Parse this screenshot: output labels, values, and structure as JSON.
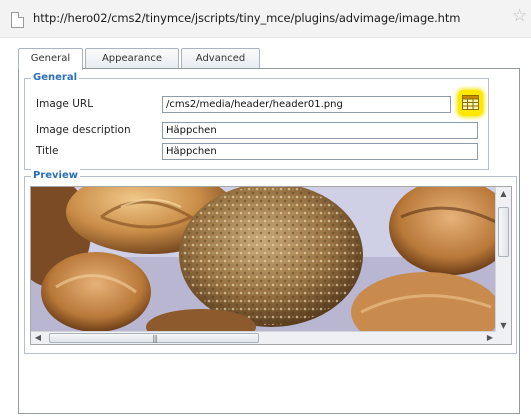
{
  "browser": {
    "url": "http://hero02/cms2/tinymce/jscripts/tiny_mce/plugins/advimage/image.htm",
    "page_icon": "page-icon",
    "bookmark_icon": "star-icon"
  },
  "tabs": [
    {
      "label": "General",
      "active": true
    },
    {
      "label": "Appearance",
      "active": false
    },
    {
      "label": "Advanced",
      "active": false
    }
  ],
  "general": {
    "legend": "General",
    "image_url": {
      "label": "Image URL",
      "value": "/cms2/media/header/header01.png"
    },
    "image_description": {
      "label": "Image description",
      "value": "Häppchen"
    },
    "title": {
      "label": "Title",
      "value": "Häppchen"
    },
    "browse_icon": "browse-icon",
    "highlight_color": "#ffe800"
  },
  "preview": {
    "legend": "Preview",
    "image_alt": "header01.png preview (pastries and bread rolls)"
  },
  "colors": {
    "legend": "#2b6fb5",
    "border": "#b6c0cc",
    "highlight": "#ffe800"
  }
}
